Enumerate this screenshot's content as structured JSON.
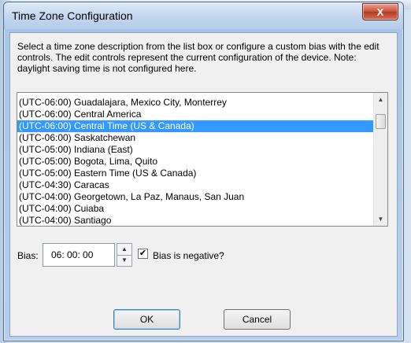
{
  "window": {
    "title": "Time Zone Configuration",
    "close_label": "X"
  },
  "description": "Select a time zone description from the list box or configure a custom bias with the edit controls.  The edit controls represent the current configuration of the device.  Note: daylight saving time is not configured here.",
  "timezones": [
    {
      "label": "(UTC-06:00) Guadalajara, Mexico City, Monterrey",
      "selected": false
    },
    {
      "label": "(UTC-06:00) Central America",
      "selected": false
    },
    {
      "label": "(UTC-06:00) Central Time (US & Canada)",
      "selected": true
    },
    {
      "label": "(UTC-06:00) Saskatchewan",
      "selected": false
    },
    {
      "label": "(UTC-05:00) Indiana (East)",
      "selected": false
    },
    {
      "label": "(UTC-05:00) Bogota, Lima, Quito",
      "selected": false
    },
    {
      "label": "(UTC-05:00) Eastern Time (US & Canada)",
      "selected": false
    },
    {
      "label": "(UTC-04:30) Caracas",
      "selected": false
    },
    {
      "label": "(UTC-04:00) Georgetown, La Paz, Manaus, San Juan",
      "selected": false
    },
    {
      "label": "(UTC-04:00) Cuiaba",
      "selected": false
    },
    {
      "label": "(UTC-04:00) Santiago",
      "selected": false
    }
  ],
  "bias": {
    "label": "Bias:",
    "value": "06: 00: 00"
  },
  "bias_negative": {
    "label": "Bias is negative?",
    "checked": true,
    "check_glyph": "✔"
  },
  "buttons": {
    "ok": "OK",
    "cancel": "Cancel"
  },
  "colors": {
    "selection": "#3399ff",
    "close_button": "#c7503a"
  }
}
